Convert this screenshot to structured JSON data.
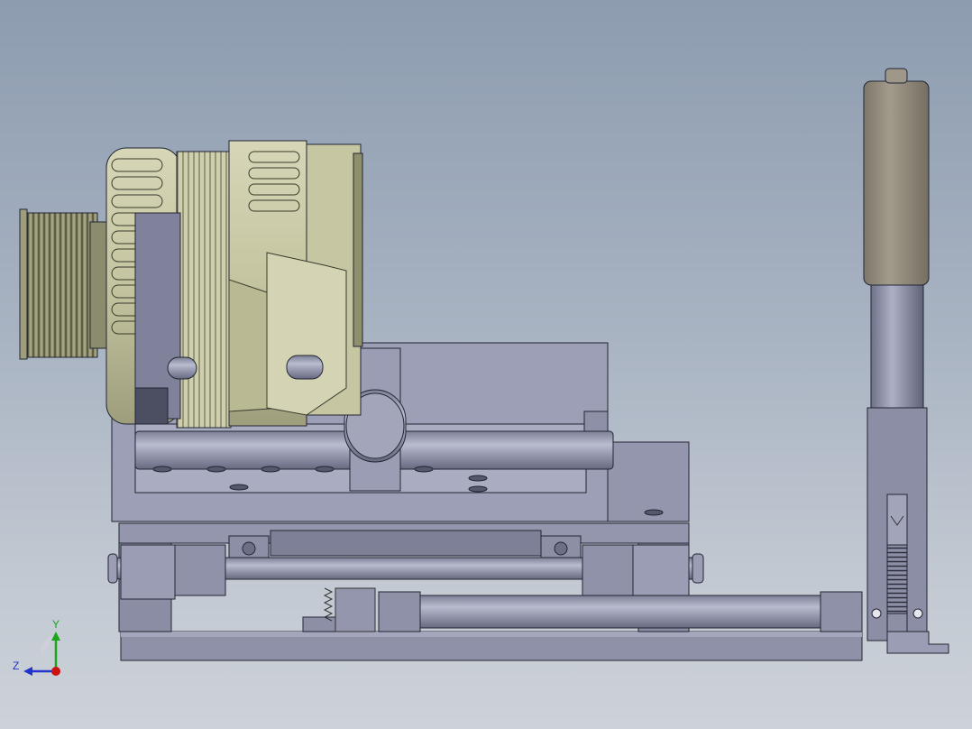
{
  "viewport": {
    "background_top": "#8d9cb0",
    "background_bottom": "#cdd2d9"
  },
  "model": {
    "components": [
      "pulley",
      "alternator",
      "mounting-bracket",
      "guide-rods",
      "base-frame",
      "slide-rail",
      "damper-cylinder",
      "rack-gear",
      "adjustment-spring"
    ],
    "colors": {
      "alternator_body": "#c9c9a6",
      "alternator_shadow": "#8f8f6c",
      "steel": "#8c8fa6",
      "steel_dark": "#5d6075",
      "steel_light": "#b4b7cb",
      "cylinder": "#9a9282",
      "edge": "#222632"
    }
  },
  "triad": {
    "y_label": "Y",
    "z_label": "Z",
    "y_color": "#1aa51a",
    "z_color": "#2233cc",
    "x_color": "#cc1111"
  }
}
